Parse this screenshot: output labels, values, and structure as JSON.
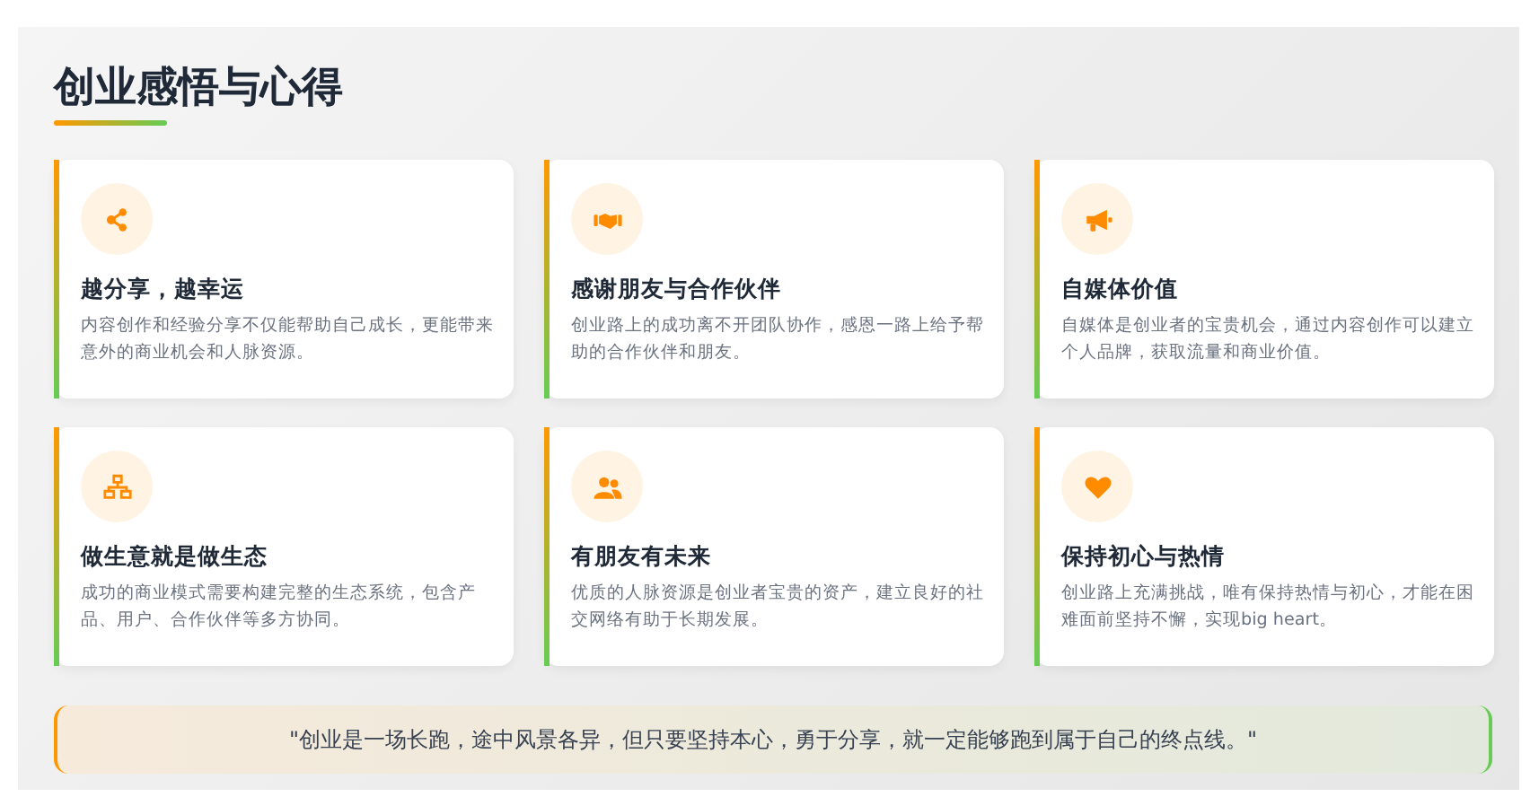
{
  "title": "创业感悟与心得",
  "cards": [
    {
      "kind": "share",
      "title": "越分享，越幸运",
      "text": "内容创作和经验分享不仅能帮助自己成长，更能带来意外的商业机会和人脉资源。"
    },
    {
      "kind": "handshake",
      "title": "感谢朋友与合作伙伴",
      "text": "创业路上的成功离不开团队协作，感恩一路上给予帮助的合作伙伴和朋友。"
    },
    {
      "kind": "megaphone",
      "title": "自媒体价值",
      "text": "自媒体是创业者的宝贵机会，通过内容创作可以建立个人品牌，获取流量和商业价值。"
    },
    {
      "kind": "network",
      "title": "做生意就是做生态",
      "text": "成功的商业模式需要构建完整的生态系统，包含产品、用户、合作伙伴等多方协同。"
    },
    {
      "kind": "people",
      "title": "有朋友有未来",
      "text": "优质的人脉资源是创业者宝贵的资产，建立良好的社交网络有助于长期发展。"
    },
    {
      "kind": "heart",
      "title": "保持初心与热情",
      "text": "创业路上充满挑战，唯有保持热情与初心，才能在困难面前坚持不懈，实现big heart。"
    }
  ],
  "quote": "\"创业是一场长跑，途中风景各异，但只要坚持本心，勇于分享，就一定能够跑到属于自己的终点线。\""
}
